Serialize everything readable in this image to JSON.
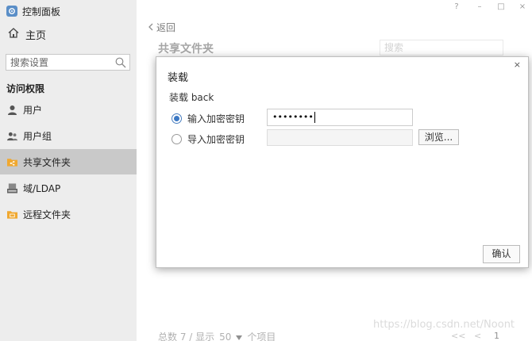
{
  "app": {
    "title": "控制面板"
  },
  "window_controls": {
    "help": "?",
    "minimize": "–",
    "maximize": "□",
    "close": "×"
  },
  "sidebar": {
    "home_label": "主页",
    "search_placeholder": "搜索设置",
    "section_title": "访问权限",
    "items": [
      {
        "label": "用户",
        "icon": "user-icon",
        "active": false
      },
      {
        "label": "用户组",
        "icon": "user-group-icon",
        "active": false
      },
      {
        "label": "共享文件夹",
        "icon": "shared-folder-icon",
        "active": true
      },
      {
        "label": "域/LDAP",
        "icon": "ldap-icon",
        "active": false
      },
      {
        "label": "远程文件夹",
        "icon": "remote-folder-icon",
        "active": false
      }
    ]
  },
  "main": {
    "back_label": "返回",
    "page_title": "共享文件夹",
    "search_placeholder": "搜索",
    "footer": {
      "total": "总数 7 / 显示",
      "per_page": "50",
      "unit": "个项目"
    },
    "pager": {
      "first": "<<",
      "prev": "<",
      "page": "1"
    }
  },
  "dialog": {
    "close": "×",
    "title": "装载",
    "subtitle": "装载 back",
    "option_enter_key": "输入加密密钥",
    "option_import_key": "导入加密密钥",
    "password_mask": "••••••••",
    "browse_label": "浏览...",
    "ok_label": "确认"
  },
  "watermark": "https://blog.csdn.net/Noont",
  "colors": {
    "accent": "#3b78c4",
    "active_item": "#c9c9c9",
    "sidebar_bg": "#ededed"
  }
}
